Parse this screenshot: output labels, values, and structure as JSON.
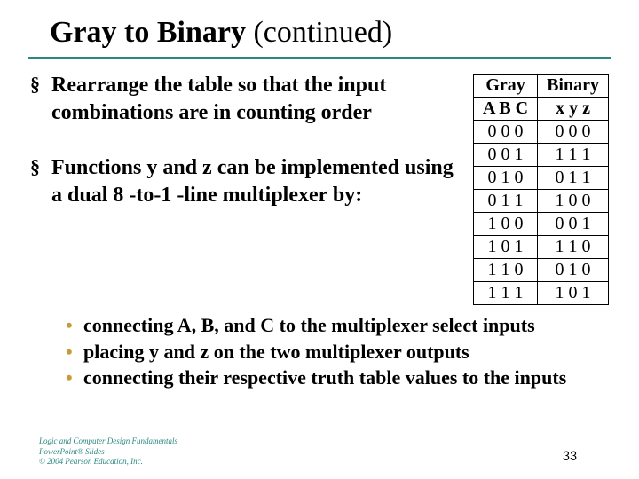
{
  "title_main": "Gray to Binary",
  "title_cont": " (continued)",
  "bullets": {
    "b1": "Rearrange the table so that the input combinations are in counting order",
    "b2": "Functions y and z can be implemented using a dual 8 -to-1 -line multiplexer by:"
  },
  "subbullets": {
    "s1": "connecting A, B, and C to the multiplexer select inputs",
    "s2": "placing y and z on the two multiplexer outputs",
    "s3": "connecting their respective truth table values to the inputs"
  },
  "table": {
    "head1_left": "Gray",
    "head1_right": "Binary",
    "head2_left": "A B C",
    "head2_right": "x y z",
    "rows": [
      {
        "g": "0 0 0",
        "b": "0 0 0"
      },
      {
        "g": "0 0 1",
        "b": "1 1 1"
      },
      {
        "g": "0 1 0",
        "b": "0 1 1"
      },
      {
        "g": "0 1 1",
        "b": "1 0 0"
      },
      {
        "g": "1 0 0",
        "b": "0 0 1"
      },
      {
        "g": "1 0 1",
        "b": "1 1 0"
      },
      {
        "g": "1 1 0",
        "b": "0 1 0"
      },
      {
        "g": "1 1 1",
        "b": "1 0 1"
      }
    ]
  },
  "footer": {
    "l1": "Logic and Computer Design Fundamentals",
    "l2": "PowerPoint® Slides",
    "l3": "© 2004 Pearson Education, Inc."
  },
  "page": "33"
}
